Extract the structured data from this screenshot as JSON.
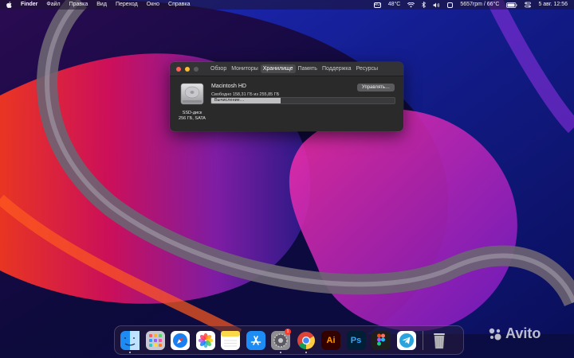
{
  "menubar": {
    "app_name": "Finder",
    "menus": [
      "Файл",
      "Правка",
      "Вид",
      "Переход",
      "Окно",
      "Справка"
    ],
    "status": {
      "temperature": "48°C",
      "fan": "5657rpm / 66°C",
      "datetime": "5 авг.  12:56"
    },
    "icons": [
      "apple-icon",
      "keyboard-layout-icon",
      "wifi-icon",
      "bluetooth-icon",
      "volume-icon",
      "battery-icon",
      "control-center-icon"
    ]
  },
  "window": {
    "tabs": [
      "Обзор",
      "Мониторы",
      "Хранилище",
      "Память",
      "Поддержка",
      "Ресурсы"
    ],
    "active_tab": "Хранилище",
    "volume_name": "Macintosh HD",
    "free_text": "Свободно 158,31 ГБ из 255,85 ГБ",
    "manage_label": "Управлять…",
    "progress_label": "Вычисление…",
    "progress_fraction": 0.38,
    "disk_type": "SSD-диск",
    "disk_info": "256 ГБ, SATA"
  },
  "dock": {
    "apps": [
      {
        "name": "Finder",
        "icon": "finder-icon",
        "color": "#1e8bf3",
        "running": true
      },
      {
        "name": "Launchpad",
        "icon": "launchpad-icon",
        "color": "#b6b7c2",
        "running": false
      },
      {
        "name": "Safari",
        "icon": "safari-icon",
        "color": "#1a7ff0",
        "running": false
      },
      {
        "name": "Photos",
        "icon": "photos-icon",
        "color": "#ffffff",
        "running": false
      },
      {
        "name": "Notes",
        "icon": "notes-icon",
        "color": "#fbd84a",
        "running": false
      },
      {
        "name": "App Store",
        "icon": "app-store-icon",
        "color": "#1d8df5",
        "running": false
      },
      {
        "name": "System Preferences",
        "icon": "system-preferences-icon",
        "color": "#8e8e93",
        "running": true,
        "badge": "1"
      },
      {
        "name": "Chrome",
        "icon": "chrome-icon",
        "color": "#ffffff",
        "running": true
      },
      {
        "name": "Illustrator",
        "icon": "illustrator-icon",
        "color": "#330000",
        "running": false,
        "text": "Ai"
      },
      {
        "name": "Photoshop",
        "icon": "photoshop-icon",
        "color": "#001e36",
        "running": false,
        "text": "Ps"
      },
      {
        "name": "Figma",
        "icon": "figma-icon",
        "color": "#1e1e1e",
        "running": false
      },
      {
        "name": "Telegram",
        "icon": "telegram-icon",
        "color": "#2aa3df",
        "running": false
      }
    ],
    "trash": {
      "name": "Trash",
      "icon": "trash-icon"
    }
  },
  "watermark": {
    "text": "Avito"
  }
}
